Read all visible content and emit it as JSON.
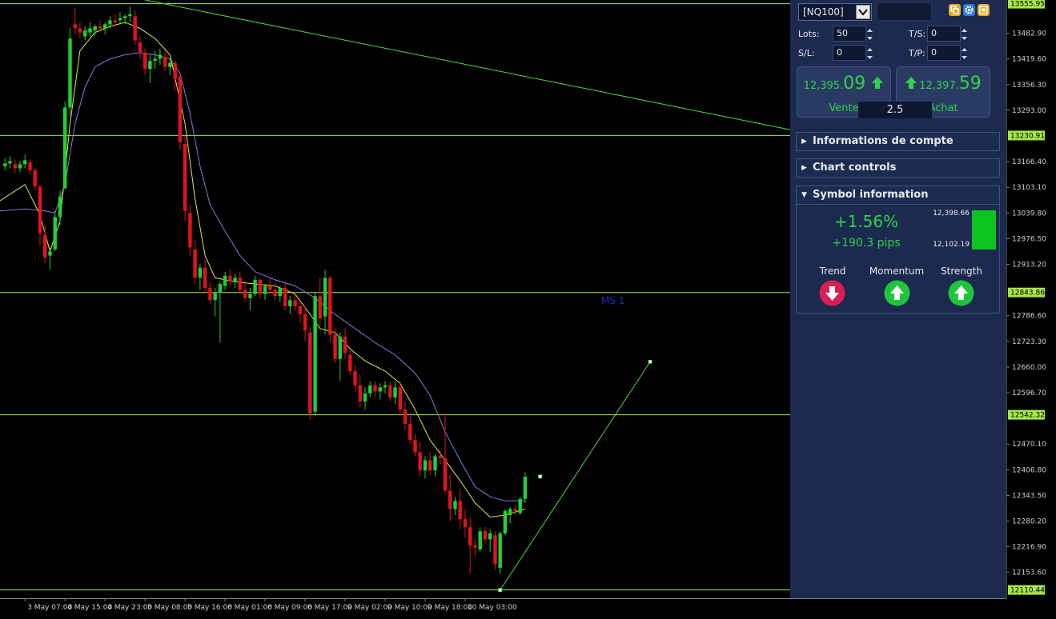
{
  "toolbar": {
    "symbol": "[NQ100]"
  },
  "trade": {
    "lots_label": "Lots:",
    "lots_value": "50",
    "sl_label": "S/L:",
    "sl_value": "0",
    "ts_label": "T/S:",
    "ts_value": "0",
    "tp_label": "T/P:",
    "tp_value": "0"
  },
  "prices": {
    "sell_small": "12,395.",
    "sell_big": "09",
    "sell_label": "Vente",
    "buy_small": "12,397.",
    "buy_big": "59",
    "buy_label": "Achat",
    "spread": "2.5"
  },
  "sections": {
    "account": "Informations de compte",
    "chart_controls": "Chart controls",
    "symbol_info": "Symbol information"
  },
  "symbol_info": {
    "change_pct": "+1.56%",
    "change_pips": "+190.3 pips",
    "range_high": "12,398.66",
    "range_low": "12,102.19",
    "trend_label": "Trend",
    "momentum_label": "Momentum",
    "strength_label": "Strength",
    "trend": "down",
    "momentum": "up",
    "strength": "up"
  },
  "colors": {
    "bull": "#22d12e",
    "bear": "#e0141c",
    "hline": "#a6e64a",
    "trendline": "#4edc3a",
    "ma_fast": "#dfe94a",
    "ma_slow": "#7e7ee2",
    "panel_bg": "#1b2a4e",
    "up_icon": "#1ec63a",
    "down_icon": "#d81f55"
  },
  "chart_data": {
    "type": "candlestick",
    "price_axis_ticks": [
      "13482.90",
      "13419.60",
      "13356.30",
      "13293.00",
      "13166.40",
      "13103.10",
      "13039.80",
      "12976.50",
      "12913.20",
      "12786.60",
      "12723.30",
      "12660.00",
      "12596.70",
      "12470.10",
      "12406.80",
      "12343.50",
      "12280.20",
      "12216.90",
      "12153.60"
    ],
    "price_tags": [
      "13555.95",
      "13230.91",
      "12843.86",
      "12542.32",
      "12110.44"
    ],
    "horizontal_levels": [
      13555.95,
      13230.91,
      12843.86,
      12542.32,
      12110.44
    ],
    "time_ticks": [
      {
        "label": "3 May 07:00",
        "x": 0
      },
      {
        "label": "4 May 15:00",
        "x": 8
      },
      {
        "label": "4 May 23:00",
        "x": 16
      },
      {
        "label": "5 May 08:00",
        "x": 24
      },
      {
        "label": "5 May 16:00",
        "x": 32
      },
      {
        "label": "6 May 01:00",
        "x": 40
      },
      {
        "label": "6 May 09:00",
        "x": 48
      },
      {
        "label": "6 May 17:00",
        "x": 56
      },
      {
        "label": "9 May 02:00",
        "x": 64
      },
      {
        "label": "9 May 10:00",
        "x": 72
      },
      {
        "label": "9 May 18:00",
        "x": 80
      },
      {
        "label": "10 May 03:00",
        "x": 88
      }
    ],
    "price_range": [
      12090,
      13565
    ],
    "x_range": [
      -5,
      153
    ],
    "annotation": "MS 1",
    "candles": [
      [
        -4,
        13155,
        13175,
        13145,
        13162
      ],
      [
        -3,
        13162,
        13180,
        13150,
        13168
      ],
      [
        -2,
        13160,
        13172,
        13138,
        13150
      ],
      [
        -1,
        13150,
        13168,
        13140,
        13160
      ],
      [
        0,
        13160,
        13185,
        13150,
        13170
      ],
      [
        1,
        13165,
        13172,
        13135,
        13145
      ],
      [
        2,
        13145,
        13152,
        13095,
        13105
      ],
      [
        3,
        13105,
        13110,
        12960,
        12990
      ],
      [
        4,
        12985,
        13010,
        12915,
        12930
      ],
      [
        5,
        12935,
        12955,
        12900,
        12945
      ],
      [
        6,
        12950,
        13045,
        12945,
        13030
      ],
      [
        7,
        13030,
        13095,
        13010,
        13080
      ],
      [
        8,
        13100,
        13315,
        13100,
        13300
      ],
      [
        9,
        13300,
        13495,
        13280,
        13470
      ],
      [
        10,
        13505,
        13545,
        13480,
        13495
      ],
      [
        11,
        13495,
        13510,
        13470,
        13485
      ],
      [
        12,
        13475,
        13500,
        13465,
        13490
      ],
      [
        13,
        13485,
        13510,
        13475,
        13495
      ],
      [
        14,
        13490,
        13505,
        13475,
        13500
      ],
      [
        15,
        13500,
        13515,
        13485,
        13495
      ],
      [
        16,
        13495,
        13510,
        13480,
        13505
      ],
      [
        17,
        13505,
        13525,
        13495,
        13515
      ],
      [
        18,
        13515,
        13530,
        13500,
        13510
      ],
      [
        19,
        13515,
        13535,
        13505,
        13520
      ],
      [
        20,
        13520,
        13530,
        13505,
        13525
      ],
      [
        21,
        13525,
        13550,
        13510,
        13530
      ],
      [
        22,
        13525,
        13540,
        13455,
        13465
      ],
      [
        23,
        13460,
        13475,
        13420,
        13435
      ],
      [
        24,
        13435,
        13445,
        13380,
        13395
      ],
      [
        25,
        13395,
        13430,
        13360,
        13415
      ],
      [
        26,
        13415,
        13440,
        13395,
        13420
      ],
      [
        27,
        13420,
        13445,
        13405,
        13430
      ],
      [
        28,
        13425,
        13440,
        13390,
        13400
      ],
      [
        29,
        13400,
        13420,
        13380,
        13410
      ],
      [
        30,
        13410,
        13415,
        13340,
        13370
      ],
      [
        31,
        13375,
        13385,
        13195,
        13215
      ],
      [
        32,
        13210,
        13230,
        13020,
        13045
      ],
      [
        33,
        13040,
        13060,
        12935,
        12955
      ],
      [
        34,
        12950,
        12975,
        12865,
        12880
      ],
      [
        35,
        12880,
        12915,
        12850,
        12905
      ],
      [
        36,
        12905,
        12925,
        12840,
        12855
      ],
      [
        37,
        12855,
        12870,
        12815,
        12825
      ],
      [
        38,
        12825,
        12855,
        12785,
        12845
      ],
      [
        39,
        12845,
        12870,
        12720,
        12865
      ],
      [
        40,
        12860,
        12895,
        12850,
        12885
      ],
      [
        41,
        12885,
        12900,
        12860,
        12870
      ],
      [
        42,
        12870,
        12890,
        12855,
        12880
      ],
      [
        43,
        12880,
        12895,
        12840,
        12850
      ],
      [
        44,
        12850,
        12870,
        12820,
        12830
      ],
      [
        45,
        12830,
        12855,
        12800,
        12840
      ],
      [
        46,
        12840,
        12885,
        12835,
        12875
      ],
      [
        47,
        12875,
        12880,
        12830,
        12840
      ],
      [
        48,
        12840,
        12865,
        12825,
        12860
      ],
      [
        49,
        12860,
        12880,
        12845,
        12850
      ],
      [
        50,
        12850,
        12865,
        12825,
        12835
      ],
      [
        51,
        12835,
        12860,
        12820,
        12855
      ],
      [
        52,
        12855,
        12870,
        12800,
        12810
      ],
      [
        53,
        12810,
        12835,
        12790,
        12825
      ],
      [
        54,
        12825,
        12845,
        12800,
        12810
      ],
      [
        55,
        12810,
        12825,
        12770,
        12790
      ],
      [
        56,
        12790,
        12810,
        12725,
        12750
      ],
      [
        57,
        12745,
        12760,
        12530,
        12545
      ],
      [
        58,
        12550,
        12845,
        12540,
        12835
      ],
      [
        59,
        12835,
        12880,
        12760,
        12780
      ],
      [
        60,
        12785,
        12900,
        12740,
        12880
      ],
      [
        61,
        12880,
        12885,
        12720,
        12740
      ],
      [
        62,
        12740,
        12755,
        12670,
        12680
      ],
      [
        63,
        12680,
        12745,
        12625,
        12735
      ],
      [
        64,
        12735,
        12755,
        12680,
        12695
      ],
      [
        65,
        12690,
        12700,
        12640,
        12650
      ],
      [
        66,
        12650,
        12665,
        12600,
        12615
      ],
      [
        67,
        12615,
        12640,
        12560,
        12575
      ],
      [
        68,
        12575,
        12610,
        12555,
        12595
      ],
      [
        69,
        12595,
        12625,
        12585,
        12615
      ],
      [
        70,
        12615,
        12625,
        12585,
        12600
      ],
      [
        71,
        12600,
        12620,
        12580,
        12610
      ],
      [
        72,
        12610,
        12625,
        12595,
        12615
      ],
      [
        73,
        12615,
        12625,
        12575,
        12585
      ],
      [
        74,
        12585,
        12625,
        12570,
        12610
      ],
      [
        75,
        12610,
        12625,
        12540,
        12555
      ],
      [
        76,
        12555,
        12575,
        12505,
        12520
      ],
      [
        77,
        12520,
        12540,
        12470,
        12480
      ],
      [
        78,
        12480,
        12495,
        12440,
        12450
      ],
      [
        79,
        12450,
        12475,
        12390,
        12405
      ],
      [
        80,
        12405,
        12440,
        12385,
        12430
      ],
      [
        81,
        12430,
        12450,
        12395,
        12405
      ],
      [
        82,
        12405,
        12445,
        12390,
        12440
      ],
      [
        83,
        12440,
        12455,
        12420,
        12435
      ],
      [
        84,
        12435,
        12545,
        12345,
        12355
      ],
      [
        85,
        12355,
        12395,
        12280,
        12310
      ],
      [
        86,
        12310,
        12340,
        12295,
        12330
      ],
      [
        87,
        12330,
        12360,
        12260,
        12285
      ],
      [
        88,
        12285,
        12310,
        12240,
        12265
      ],
      [
        89,
        12265,
        12290,
        12150,
        12220
      ],
      [
        90,
        12220,
        12235,
        12195,
        12215
      ],
      [
        91,
        12210,
        12265,
        12205,
        12255
      ],
      [
        92,
        12255,
        12265,
        12225,
        12235
      ],
      [
        93,
        12235,
        12260,
        12205,
        12250
      ],
      [
        94,
        12245,
        12255,
        12160,
        12175
      ],
      [
        95,
        12165,
        12255,
        12150,
        12250
      ],
      [
        96,
        12250,
        12310,
        12245,
        12305
      ],
      [
        97,
        12295,
        12315,
        12275,
        12310
      ],
      [
        98,
        12310,
        12320,
        12295,
        12305
      ],
      [
        99,
        12300,
        12340,
        12295,
        12335
      ],
      [
        100,
        12335,
        12400,
        12325,
        12390
      ]
    ],
    "ma_fast": [
      [
        -5,
        13070
      ],
      [
        0,
        13110
      ],
      [
        3,
        13035
      ],
      [
        5,
        12945
      ],
      [
        7,
        13020
      ],
      [
        9,
        13260
      ],
      [
        11,
        13440
      ],
      [
        14,
        13485
      ],
      [
        17,
        13500
      ],
      [
        20,
        13510
      ],
      [
        23,
        13495
      ],
      [
        26,
        13470
      ],
      [
        29,
        13430
      ],
      [
        32,
        13260
      ],
      [
        34,
        13075
      ],
      [
        36,
        12935
      ],
      [
        38,
        12880
      ],
      [
        42,
        12870
      ],
      [
        46,
        12865
      ],
      [
        50,
        12860
      ],
      [
        54,
        12840
      ],
      [
        57,
        12790
      ],
      [
        59,
        12755
      ],
      [
        62,
        12745
      ],
      [
        65,
        12705
      ],
      [
        68,
        12675
      ],
      [
        72,
        12650
      ],
      [
        75,
        12620
      ],
      [
        78,
        12555
      ],
      [
        81,
        12480
      ],
      [
        84,
        12430
      ],
      [
        87,
        12380
      ],
      [
        90,
        12325
      ],
      [
        93,
        12290
      ],
      [
        96,
        12295
      ],
      [
        100,
        12310
      ]
    ],
    "ma_slow": [
      [
        -5,
        13045
      ],
      [
        0,
        13050
      ],
      [
        4,
        13045
      ],
      [
        6,
        13040
      ],
      [
        8,
        13110
      ],
      [
        10,
        13260
      ],
      [
        12,
        13350
      ],
      [
        14,
        13400
      ],
      [
        17,
        13420
      ],
      [
        20,
        13430
      ],
      [
        23,
        13435
      ],
      [
        26,
        13430
      ],
      [
        29,
        13420
      ],
      [
        31,
        13385
      ],
      [
        33,
        13285
      ],
      [
        35,
        13155
      ],
      [
        37,
        13060
      ],
      [
        40,
        12995
      ],
      [
        43,
        12935
      ],
      [
        46,
        12895
      ],
      [
        50,
        12875
      ],
      [
        54,
        12860
      ],
      [
        58,
        12830
      ],
      [
        62,
        12790
      ],
      [
        66,
        12755
      ],
      [
        70,
        12720
      ],
      [
        74,
        12690
      ],
      [
        78,
        12645
      ],
      [
        81,
        12590
      ],
      [
        84,
        12500
      ],
      [
        87,
        12430
      ],
      [
        90,
        12365
      ],
      [
        93,
        12340
      ],
      [
        96,
        12330
      ],
      [
        100,
        12330
      ]
    ],
    "trendlines": [
      {
        "x1": 12,
        "y1": 13595,
        "x2": 153,
        "y2": 13245
      },
      {
        "x1": 95,
        "y1": 12110,
        "x2": 125,
        "y2": 12673
      }
    ],
    "markers": [
      [
        95,
        12110
      ],
      [
        103,
        12390
      ],
      [
        125,
        12673
      ]
    ]
  }
}
